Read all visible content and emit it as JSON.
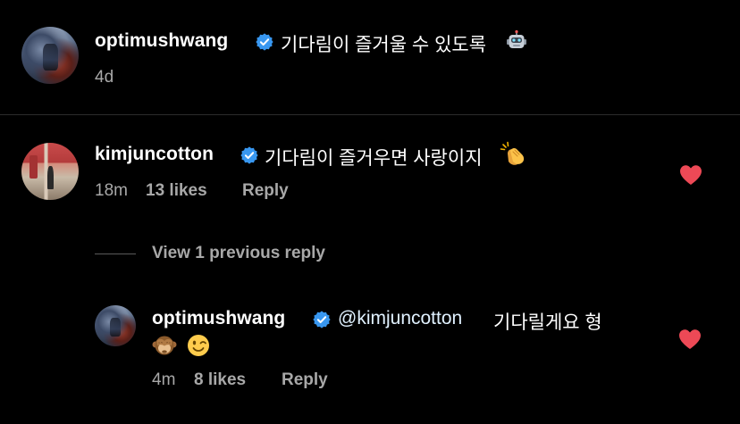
{
  "caption": {
    "username": "optimushwang",
    "verified": true,
    "text": "기다림이 즐거울 수 있도록",
    "trailing_emoji": "robot-emoji",
    "time": "4d"
  },
  "comments": [
    {
      "username": "kimjuncotton",
      "verified": true,
      "text": "기다림이 즐거우면 사랑이지",
      "trailing_emoji": "clapping-hands-emoji",
      "time": "18m",
      "likes": "13 likes",
      "reply_label": "Reply",
      "liked": true
    }
  ],
  "view_replies": {
    "label": "View 1 previous reply"
  },
  "reply": {
    "username": "optimushwang",
    "verified": true,
    "mention": "@kimjuncotton",
    "text": "기다릴게요 형",
    "emojis": [
      "see-no-evil-monkey-emoji",
      "winking-face-emoji"
    ],
    "time": "4m",
    "likes": "8 likes",
    "reply_label": "Reply",
    "liked": true
  },
  "colors": {
    "background": "#000000",
    "text_primary": "#ffffff",
    "text_secondary": "#a8a8a8",
    "verified_blue": "#3897f0",
    "heart_red": "#ed4956",
    "divider": "#2b2b2b"
  }
}
